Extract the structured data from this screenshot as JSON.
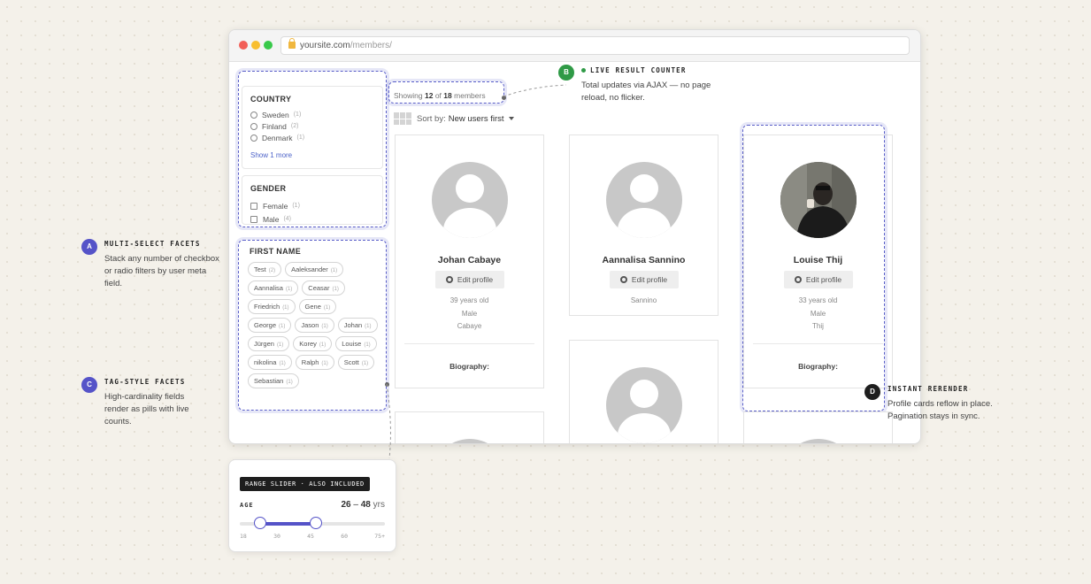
{
  "browser": {
    "url_host": "yoursite.com",
    "url_path": "/members/"
  },
  "facets": {
    "country": {
      "title": "COUNTRY",
      "options": [
        {
          "label": "Sweden",
          "count": "(1)"
        },
        {
          "label": "Finland",
          "count": "(2)"
        },
        {
          "label": "Denmark",
          "count": "(1)"
        }
      ],
      "show_more": "Show 1 more"
    },
    "gender": {
      "title": "GENDER",
      "options": [
        {
          "label": "Female",
          "count": "(1)"
        },
        {
          "label": "Male",
          "count": "(4)"
        }
      ]
    },
    "first_name": {
      "title": "FIRST NAME",
      "pills": [
        {
          "label": "Test",
          "count": "(2)"
        },
        {
          "label": "Aaleksander",
          "count": "(1)"
        },
        {
          "label": "Aannalisa",
          "count": "(1)"
        },
        {
          "label": "Ceasar",
          "count": "(1)"
        },
        {
          "label": "Friedrich",
          "count": "(1)"
        },
        {
          "label": "Gene",
          "count": "(1)"
        },
        {
          "label": "George",
          "count": "(1)"
        },
        {
          "label": "Jason",
          "count": "(1)"
        },
        {
          "label": "Johan",
          "count": "(1)"
        },
        {
          "label": "Jürgen",
          "count": "(1)"
        },
        {
          "label": "Korey",
          "count": "(1)"
        },
        {
          "label": "Louise",
          "count": "(1)"
        },
        {
          "label": "nikolina",
          "count": "(1)"
        },
        {
          "label": "Ralph",
          "count": "(1)"
        },
        {
          "label": "Scott",
          "count": "(1)"
        },
        {
          "label": "Sebastian",
          "count": "(1)"
        }
      ]
    }
  },
  "results": {
    "prefix": "Showing",
    "shown": "12",
    "of": "of",
    "total": "18",
    "suffix": "members",
    "sort_label": "Sort by:",
    "sort_value": "New users first"
  },
  "cards": [
    {
      "name": "Johan Cabaye",
      "edit": "Edit profile",
      "meta": [
        "39 years old",
        "Male",
        "Cabaye"
      ],
      "bio": "Biography:"
    },
    {
      "name": "Aannalisa Sannino",
      "edit": "Edit profile",
      "meta": [
        "Sannino"
      ],
      "bio": ""
    },
    {
      "name": "Louise Thij",
      "edit": "Edit profile",
      "meta": [
        "33 years old",
        "Male",
        "Thij"
      ],
      "bio": "Biography:"
    }
  ],
  "annotations": {
    "a": {
      "badge": "A",
      "title": "MULTI-SELECT FACETS",
      "text": "Stack any number of checkbox or radio filters by user meta field."
    },
    "b": {
      "badge": "B",
      "title": "LIVE RESULT COUNTER",
      "text": "Total updates via AJAX — no page reload, no flicker."
    },
    "c": {
      "badge": "C",
      "title": "TAG-STYLE FACETS",
      "text": "High-cardinality fields render as pills with live counts."
    },
    "d": {
      "badge": "D",
      "title": "INSTANT RERENDER",
      "text": "Profile cards reflow in place. Pagination stays in sync."
    }
  },
  "range": {
    "badge": "RANGE SLIDER · ALSO INCLUDED",
    "label": "AGE",
    "min_value": "26",
    "dash": "–",
    "max_value": "48",
    "unit": "yrs",
    "scale_min": 18,
    "scale_max": 75,
    "low": 26,
    "high": 48,
    "ticks": [
      "18",
      "30",
      "45",
      "60",
      "75+"
    ]
  },
  "colors": {
    "accent": "#5553c8",
    "green": "#2f9a46",
    "dark": "#1e1e1e"
  }
}
